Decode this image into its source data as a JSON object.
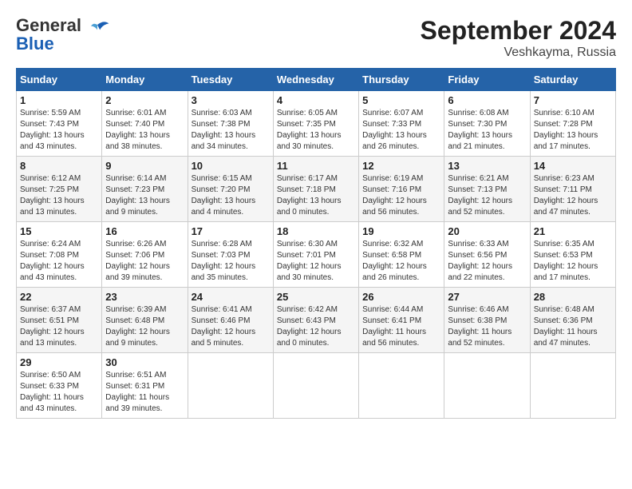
{
  "logo": {
    "line1": "General",
    "line2": "Blue"
  },
  "title": "September 2024",
  "subtitle": "Veshkayma, Russia",
  "days_header": [
    "Sunday",
    "Monday",
    "Tuesday",
    "Wednesday",
    "Thursday",
    "Friday",
    "Saturday"
  ],
  "weeks": [
    [
      {
        "day": "1",
        "sunrise": "5:59 AM",
        "sunset": "7:43 PM",
        "daylight": "13 hours and 43 minutes."
      },
      {
        "day": "2",
        "sunrise": "6:01 AM",
        "sunset": "7:40 PM",
        "daylight": "13 hours and 38 minutes."
      },
      {
        "day": "3",
        "sunrise": "6:03 AM",
        "sunset": "7:38 PM",
        "daylight": "13 hours and 34 minutes."
      },
      {
        "day": "4",
        "sunrise": "6:05 AM",
        "sunset": "7:35 PM",
        "daylight": "13 hours and 30 minutes."
      },
      {
        "day": "5",
        "sunrise": "6:07 AM",
        "sunset": "7:33 PM",
        "daylight": "13 hours and 26 minutes."
      },
      {
        "day": "6",
        "sunrise": "6:08 AM",
        "sunset": "7:30 PM",
        "daylight": "13 hours and 21 minutes."
      },
      {
        "day": "7",
        "sunrise": "6:10 AM",
        "sunset": "7:28 PM",
        "daylight": "13 hours and 17 minutes."
      }
    ],
    [
      {
        "day": "8",
        "sunrise": "6:12 AM",
        "sunset": "7:25 PM",
        "daylight": "13 hours and 13 minutes."
      },
      {
        "day": "9",
        "sunrise": "6:14 AM",
        "sunset": "7:23 PM",
        "daylight": "13 hours and 9 minutes."
      },
      {
        "day": "10",
        "sunrise": "6:15 AM",
        "sunset": "7:20 PM",
        "daylight": "13 hours and 4 minutes."
      },
      {
        "day": "11",
        "sunrise": "6:17 AM",
        "sunset": "7:18 PM",
        "daylight": "13 hours and 0 minutes."
      },
      {
        "day": "12",
        "sunrise": "6:19 AM",
        "sunset": "7:16 PM",
        "daylight": "12 hours and 56 minutes."
      },
      {
        "day": "13",
        "sunrise": "6:21 AM",
        "sunset": "7:13 PM",
        "daylight": "12 hours and 52 minutes."
      },
      {
        "day": "14",
        "sunrise": "6:23 AM",
        "sunset": "7:11 PM",
        "daylight": "12 hours and 47 minutes."
      }
    ],
    [
      {
        "day": "15",
        "sunrise": "6:24 AM",
        "sunset": "7:08 PM",
        "daylight": "12 hours and 43 minutes."
      },
      {
        "day": "16",
        "sunrise": "6:26 AM",
        "sunset": "7:06 PM",
        "daylight": "12 hours and 39 minutes."
      },
      {
        "day": "17",
        "sunrise": "6:28 AM",
        "sunset": "7:03 PM",
        "daylight": "12 hours and 35 minutes."
      },
      {
        "day": "18",
        "sunrise": "6:30 AM",
        "sunset": "7:01 PM",
        "daylight": "12 hours and 30 minutes."
      },
      {
        "day": "19",
        "sunrise": "6:32 AM",
        "sunset": "6:58 PM",
        "daylight": "12 hours and 26 minutes."
      },
      {
        "day": "20",
        "sunrise": "6:33 AM",
        "sunset": "6:56 PM",
        "daylight": "12 hours and 22 minutes."
      },
      {
        "day": "21",
        "sunrise": "6:35 AM",
        "sunset": "6:53 PM",
        "daylight": "12 hours and 17 minutes."
      }
    ],
    [
      {
        "day": "22",
        "sunrise": "6:37 AM",
        "sunset": "6:51 PM",
        "daylight": "12 hours and 13 minutes."
      },
      {
        "day": "23",
        "sunrise": "6:39 AM",
        "sunset": "6:48 PM",
        "daylight": "12 hours and 9 minutes."
      },
      {
        "day": "24",
        "sunrise": "6:41 AM",
        "sunset": "6:46 PM",
        "daylight": "12 hours and 5 minutes."
      },
      {
        "day": "25",
        "sunrise": "6:42 AM",
        "sunset": "6:43 PM",
        "daylight": "12 hours and 0 minutes."
      },
      {
        "day": "26",
        "sunrise": "6:44 AM",
        "sunset": "6:41 PM",
        "daylight": "11 hours and 56 minutes."
      },
      {
        "day": "27",
        "sunrise": "6:46 AM",
        "sunset": "6:38 PM",
        "daylight": "11 hours and 52 minutes."
      },
      {
        "day": "28",
        "sunrise": "6:48 AM",
        "sunset": "6:36 PM",
        "daylight": "11 hours and 47 minutes."
      }
    ],
    [
      {
        "day": "29",
        "sunrise": "6:50 AM",
        "sunset": "6:33 PM",
        "daylight": "11 hours and 43 minutes."
      },
      {
        "day": "30",
        "sunrise": "6:51 AM",
        "sunset": "6:31 PM",
        "daylight": "11 hours and 39 minutes."
      },
      null,
      null,
      null,
      null,
      null
    ]
  ]
}
